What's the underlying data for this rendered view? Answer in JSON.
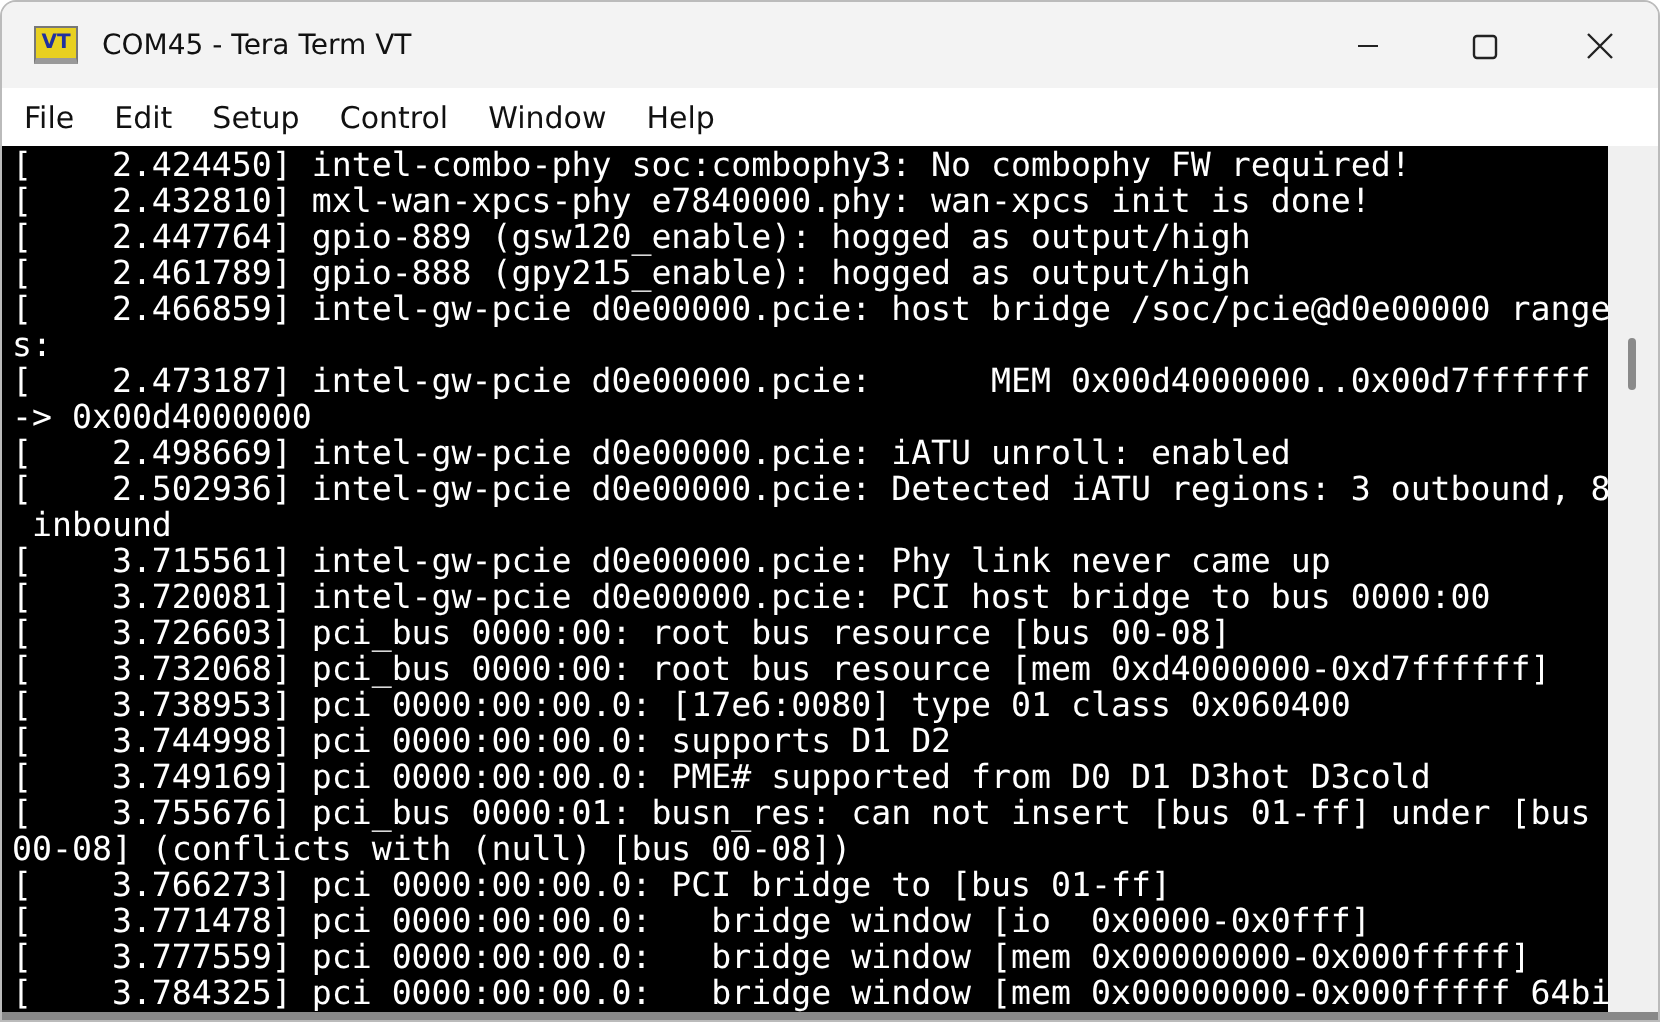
{
  "window": {
    "title": "COM45 - Tera Term VT",
    "logo": "VT"
  },
  "menu": [
    "File",
    "Edit",
    "Setup",
    "Control",
    "Window",
    "Help"
  ],
  "terminal": {
    "lines": [
      "[    2.424450] intel-combo-phy soc:combophy3: No combophy FW required!",
      "[    2.432810] mxl-wan-xpcs-phy e7840000.phy: wan-xpcs init is done!",
      "[    2.447764] gpio-889 (gsw120_enable): hogged as output/high",
      "[    2.461789] gpio-888 (gpy215_enable): hogged as output/high",
      "[    2.466859] intel-gw-pcie d0e00000.pcie: host bridge /soc/pcie@d0e00000 range",
      "s:",
      "[    2.473187] intel-gw-pcie d0e00000.pcie:      MEM 0x00d4000000..0x00d7ffffff",
      "-> 0x00d4000000",
      "[    2.498669] intel-gw-pcie d0e00000.pcie: iATU unroll: enabled",
      "[    2.502936] intel-gw-pcie d0e00000.pcie: Detected iATU regions: 3 outbound, 8",
      " inbound",
      "[    3.715561] intel-gw-pcie d0e00000.pcie: Phy link never came up",
      "[    3.720081] intel-gw-pcie d0e00000.pcie: PCI host bridge to bus 0000:00",
      "[    3.726603] pci_bus 0000:00: root bus resource [bus 00-08]",
      "[    3.732068] pci_bus 0000:00: root bus resource [mem 0xd4000000-0xd7ffffff]",
      "[    3.738953] pci 0000:00:00.0: [17e6:0080] type 01 class 0x060400",
      "[    3.744998] pci 0000:00:00.0: supports D1 D2",
      "[    3.749169] pci 0000:00:00.0: PME# supported from D0 D1 D3hot D3cold",
      "[    3.755676] pci_bus 0000:01: busn_res: can not insert [bus 01-ff] under [bus",
      "00-08] (conflicts with (null) [bus 00-08])",
      "[    3.766273] pci 0000:00:00.0: PCI bridge to [bus 01-ff]",
      "[    3.771478] pci 0000:00:00.0:   bridge window [io  0x0000-0x0fff]",
      "[    3.777559] pci 0000:00:00.0:   bridge window [mem 0x00000000-0x000fffff]",
      "[    3.784325] pci 0000:00:00.0:   bridge window [mem 0x00000000-0x000fffff 64bi"
    ]
  }
}
